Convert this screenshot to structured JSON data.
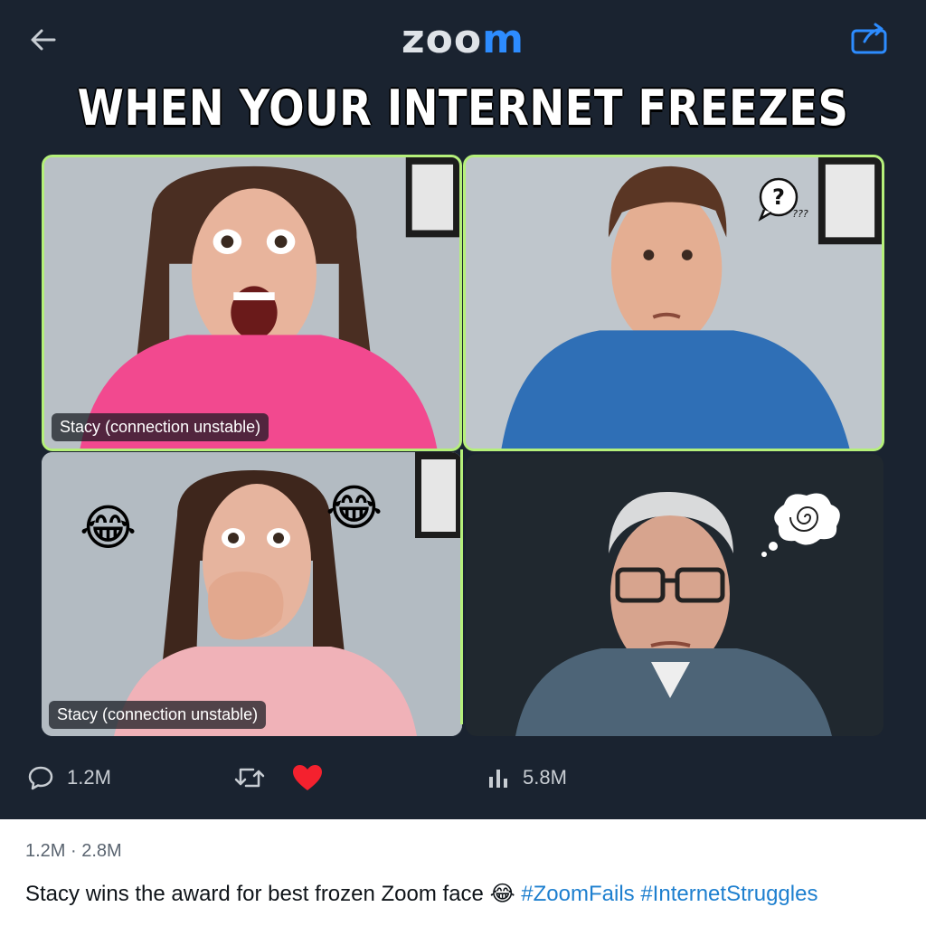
{
  "header": {
    "logo_part1": "zoo",
    "logo_part2": "m",
    "back_icon": "arrow-left-icon",
    "share_icon": "share-icon",
    "accent": "#2d8cff"
  },
  "headline": "WHEN YOUR INTERNET FREEZES",
  "tiles": [
    {
      "name": "Stacy (connection unstable)"
    },
    {
      "bubble": "?",
      "bubble_small": "???"
    },
    {
      "name": "Stacy (connection unstable)",
      "emoji_left": "😂",
      "emoji_right": "😂"
    },
    {
      "bubble_icon": "spiral-icon"
    }
  ],
  "frame_color": "#b5f07a",
  "actions": {
    "replies": "1.2M",
    "views": "5.8M",
    "retweet_icon": "retweet-icon",
    "like_icon": "heart-icon",
    "like_color": "#f4212e"
  },
  "footer": {
    "stats": "1.2M · 2.8M",
    "caption_text": "Stacy wins the award for best frozen Zoom face ",
    "caption_emoji": "😂",
    "tag1": "#ZoomFails",
    "tag2": "#InternetStruggles"
  }
}
